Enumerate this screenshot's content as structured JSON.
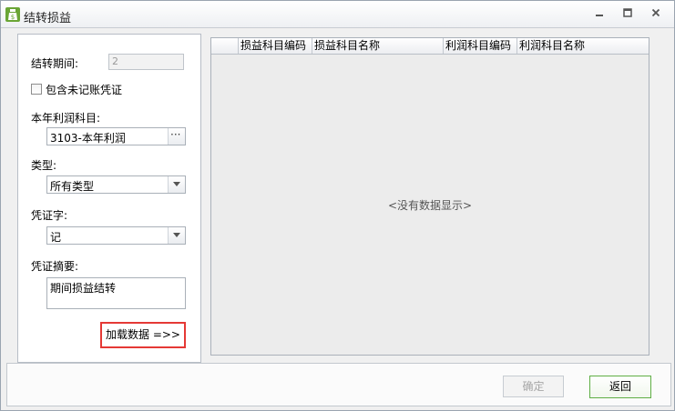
{
  "window": {
    "title": "结转损益"
  },
  "form": {
    "period_label": "结转期间:",
    "period_value": "2",
    "include_unposted_label": "包含未记账凭证",
    "include_unposted_checked": false,
    "profit_account_label": "本年利润科目:",
    "profit_account_value": "3103-本年利润",
    "browse_button": "···",
    "type_label": "类型:",
    "type_value": "所有类型",
    "voucher_word_label": "凭证字:",
    "voucher_word_value": "记",
    "summary_label": "凭证摘要:",
    "summary_value": "期间损益结转",
    "load_button": "加载数据 =>>"
  },
  "grid": {
    "columns": [
      "损益科目编码",
      "损益科目名称",
      "利润科目编码",
      "利润科目名称"
    ],
    "empty_text": "<没有数据显示>"
  },
  "footer": {
    "ok_button": "确定",
    "back_button": "返回"
  },
  "colors": {
    "highlight_border": "#e53935",
    "back_button_border": "#5fae45",
    "app_icon": "#6aa535"
  }
}
